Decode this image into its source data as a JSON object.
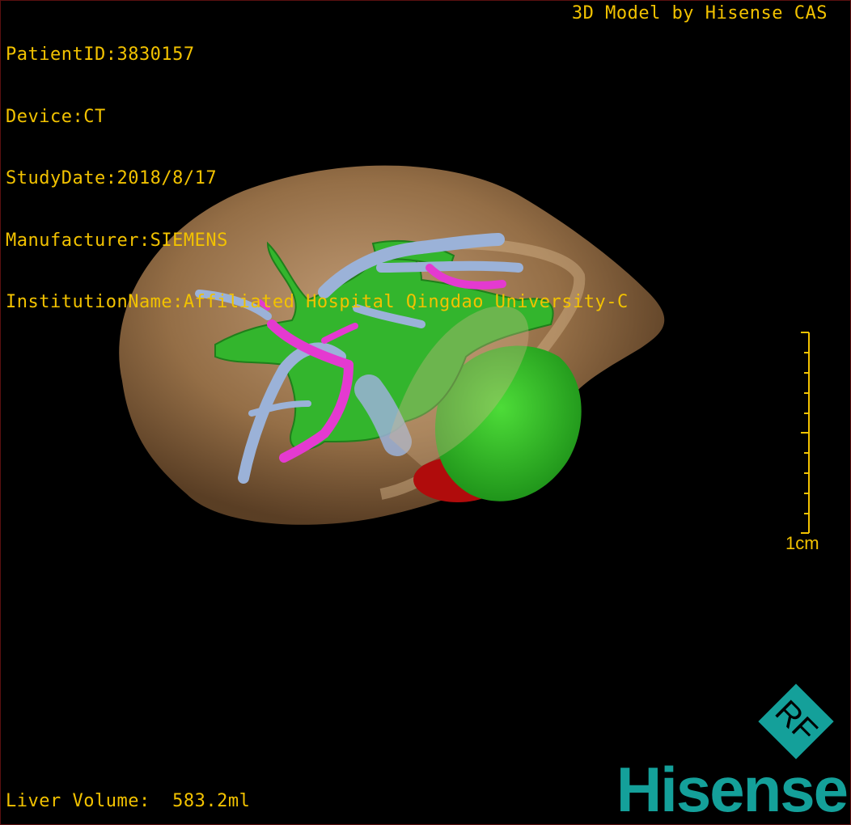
{
  "info": {
    "patient_id": "PatientID:3830157",
    "device": "Device:CT",
    "study_date": "StudyDate:2018/8/17",
    "manufacturer": "Manufacturer:SIEMENS",
    "institution": "InstitutionName:Affiliated Hospital Qingdao University-C"
  },
  "credit": "3D Model by Hisense CAS",
  "scale": {
    "label": "1cm"
  },
  "volume": "Liver Volume:  583.2ml",
  "logo": {
    "monogram": "RF",
    "brand": "Hisense"
  },
  "colors": {
    "text": "#f2c200",
    "liver": "#9c744a",
    "portal_vein": "#2fb52b",
    "hepatic_vein": "#9bb2d8",
    "artery": "#e43ad0",
    "tumor": "#c30d0d",
    "brand": "#14a09a"
  }
}
